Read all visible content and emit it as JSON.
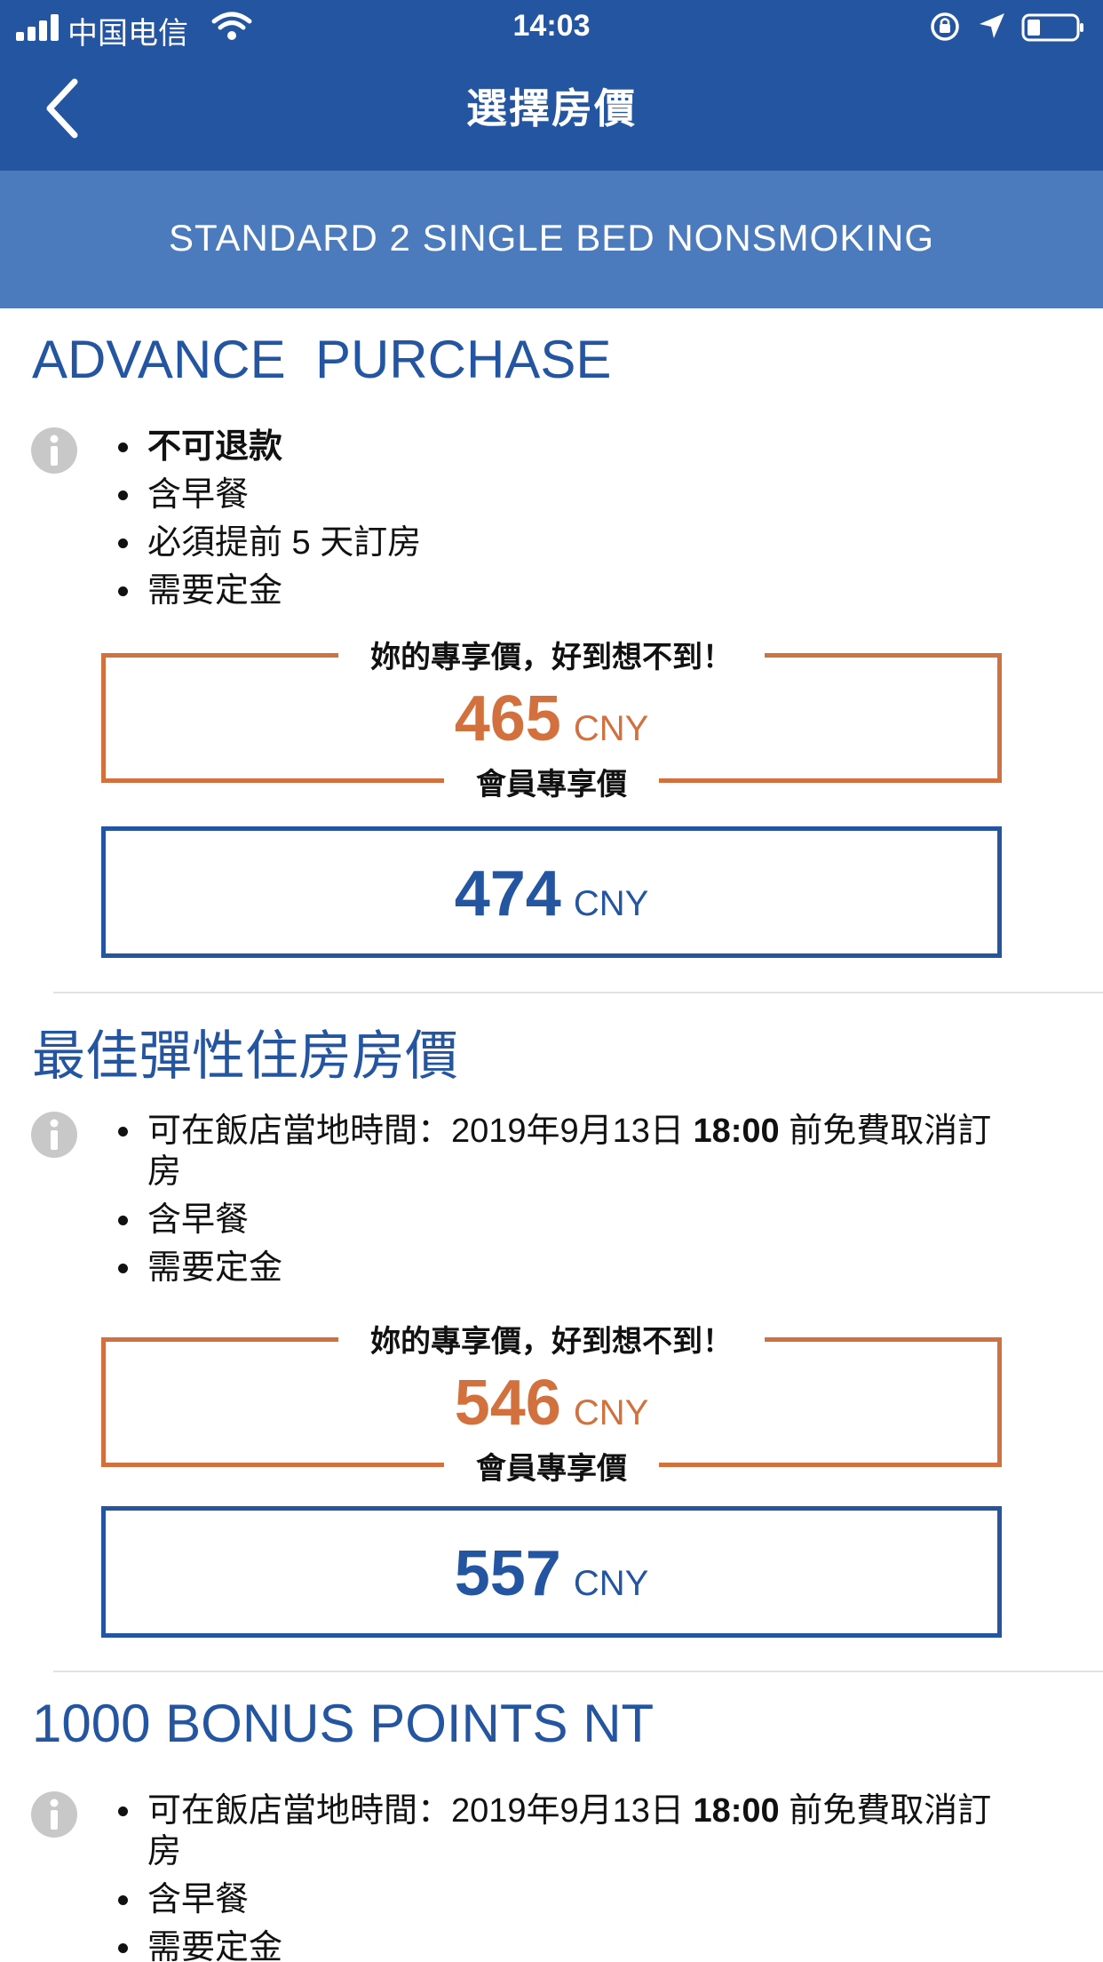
{
  "status_bar": {
    "carrier": "中国电信",
    "time": "14:03"
  },
  "nav": {
    "title": "選擇房價",
    "back_icon": "chevron-left-icon"
  },
  "room": {
    "name": "STANDARD 2 SINGLE BED NONSMOKING"
  },
  "rates": [
    {
      "title": "ADVANCE  PURCHASE",
      "features": [
        "不可退款",
        "含早餐",
        "必須提前 5 天訂房",
        "需要定金"
      ],
      "member_caption_top": "妳的專享價，好到想不到！",
      "member_price": "465",
      "member_currency": "CNY",
      "member_caption_bottom": "會員專享價",
      "standard_price": "474",
      "standard_currency": "CNY"
    },
    {
      "title": "最佳彈性住房房價",
      "cancel_prefix": "可在飯店當地時間：2019年9月13日 ",
      "cancel_time": "18:00",
      "cancel_suffix": " 前免費取消訂房",
      "features": [
        "含早餐",
        "需要定金"
      ],
      "member_caption_top": "妳的專享價，好到想不到！",
      "member_price": "546",
      "member_currency": "CNY",
      "member_caption_bottom": "會員專享價",
      "standard_price": "557",
      "standard_currency": "CNY"
    },
    {
      "title": "1000 BONUS POINTS NT",
      "cancel_prefix": "可在飯店當地時間：2019年9月13日 ",
      "cancel_time": "18:00",
      "cancel_suffix": " 前免費取消訂房",
      "features": [
        "含早餐",
        "需要定金"
      ]
    }
  ],
  "colors": {
    "brand_blue": "#2455a0",
    "band_blue": "#4b7bbd",
    "member_orange": "#d2703e"
  }
}
